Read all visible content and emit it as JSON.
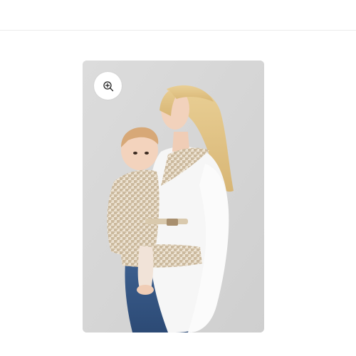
{
  "colors": {
    "page_background": "#ffffff",
    "header_divider": "#ececec",
    "photo_backdrop": "#d6d6d6",
    "zoom_button_background": "#ffffff",
    "icon_stroke": "#222222"
  },
  "product_gallery": {
    "zoom_button": {
      "icon": "zoom-in-icon"
    },
    "main_image": {
      "subject": "product-photo"
    }
  }
}
